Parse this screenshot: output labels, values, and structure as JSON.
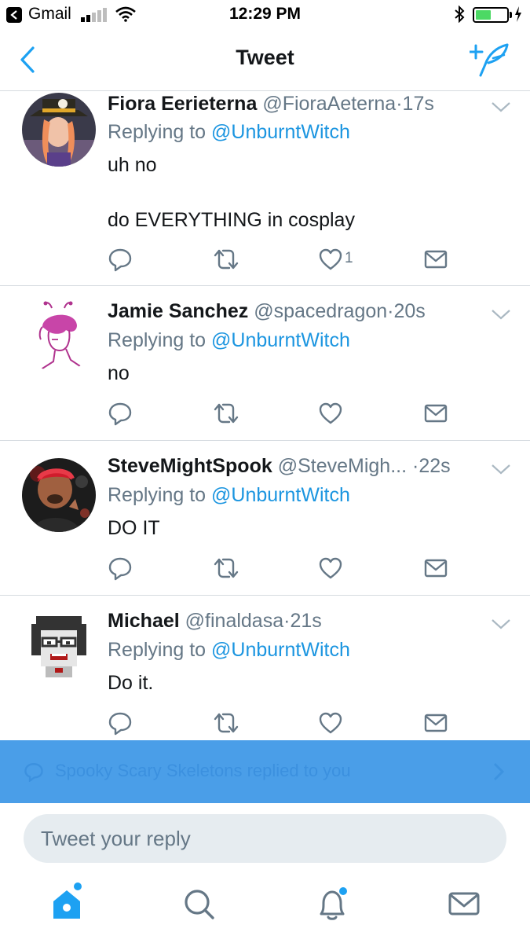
{
  "status_bar": {
    "back_app": "Gmail",
    "time": "12:29 PM"
  },
  "nav": {
    "title": "Tweet"
  },
  "tweets": [
    {
      "name": "Fiora Eerieterna",
      "handle": "@FioraAeterna",
      "separator": "·",
      "time": "17s",
      "replying_prefix": "Replying to ",
      "replying_to": "@UnburntWitch",
      "text": "uh no\n\ndo EVERYTHING in cosplay",
      "like_count": "1"
    },
    {
      "name": "Jamie Sanchez",
      "handle": "@spacedragon",
      "separator": "·",
      "time": "20s",
      "replying_prefix": "Replying to ",
      "replying_to": "@UnburntWitch",
      "text": "no",
      "like_count": ""
    },
    {
      "name": "SteveMightSpook",
      "handle": "@SteveMigh...",
      "separator": "·",
      "time": "22s",
      "replying_prefix": "Replying to ",
      "replying_to": "@UnburntWitch",
      "text": "DO IT",
      "like_count": ""
    },
    {
      "name": "Michael",
      "handle": "@finaldasa",
      "separator": "·",
      "time": "21s",
      "replying_prefix": "Replying to ",
      "replying_to": "@UnburntWitch",
      "text": "Do it.",
      "like_count": ""
    }
  ],
  "banner": {
    "text": "Spooky Scary Skeletons replied to you"
  },
  "composer": {
    "placeholder": "Tweet your reply"
  },
  "tab_bar": {
    "items": [
      "home-icon",
      "search-icon",
      "notifications-icon",
      "messages-icon"
    ]
  },
  "colors": {
    "accent": "#1da1f2",
    "banner": "#4a9ee8",
    "mention": "#1b95e0",
    "secondary_text": "#657786"
  }
}
